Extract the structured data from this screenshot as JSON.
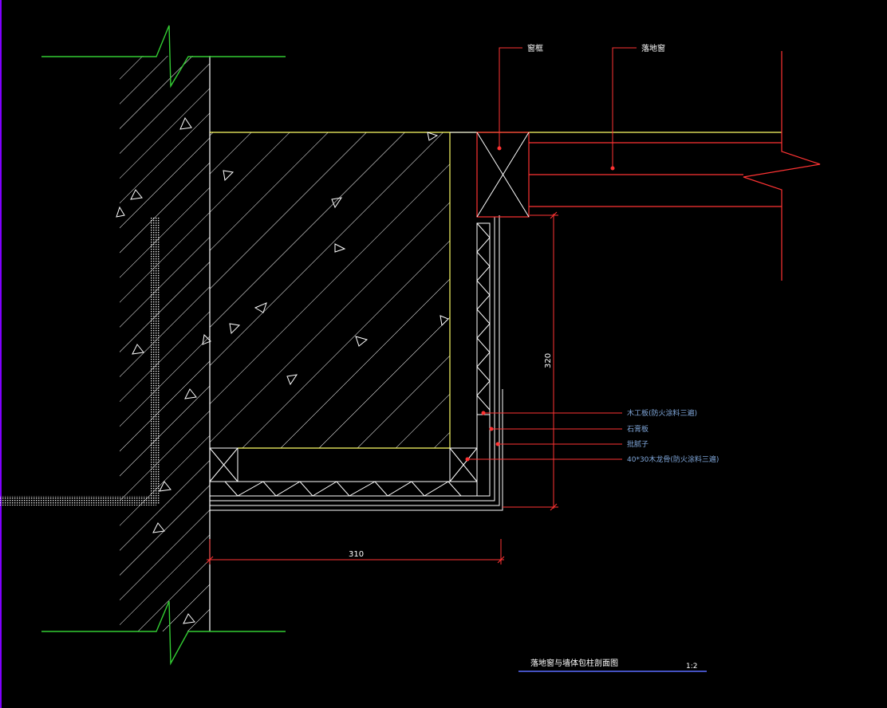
{
  "labels": {
    "window_frame": "窗框",
    "floor_window": "落地窗",
    "note_wood_base": "木工板(防火涂料三遍)",
    "note_gypsum": "石膏板",
    "note_putty": "批腻子",
    "note_batten": "40*30木龙骨(防火涂料三遍)",
    "dim_height": "320",
    "dim_width": "310",
    "title": "落地窗与墙体包柱剖面图",
    "scale": "1:2"
  },
  "colors": {
    "background": "#000000",
    "wall_outline": "#ffffff",
    "hatch": "#ffffff",
    "column_outline": "#ffff66",
    "break_line": "#33cc33",
    "leader": "#ff3333",
    "note_text": "#7fa6d9",
    "title_underline": "#5b6cff",
    "border": "#8000ff"
  }
}
